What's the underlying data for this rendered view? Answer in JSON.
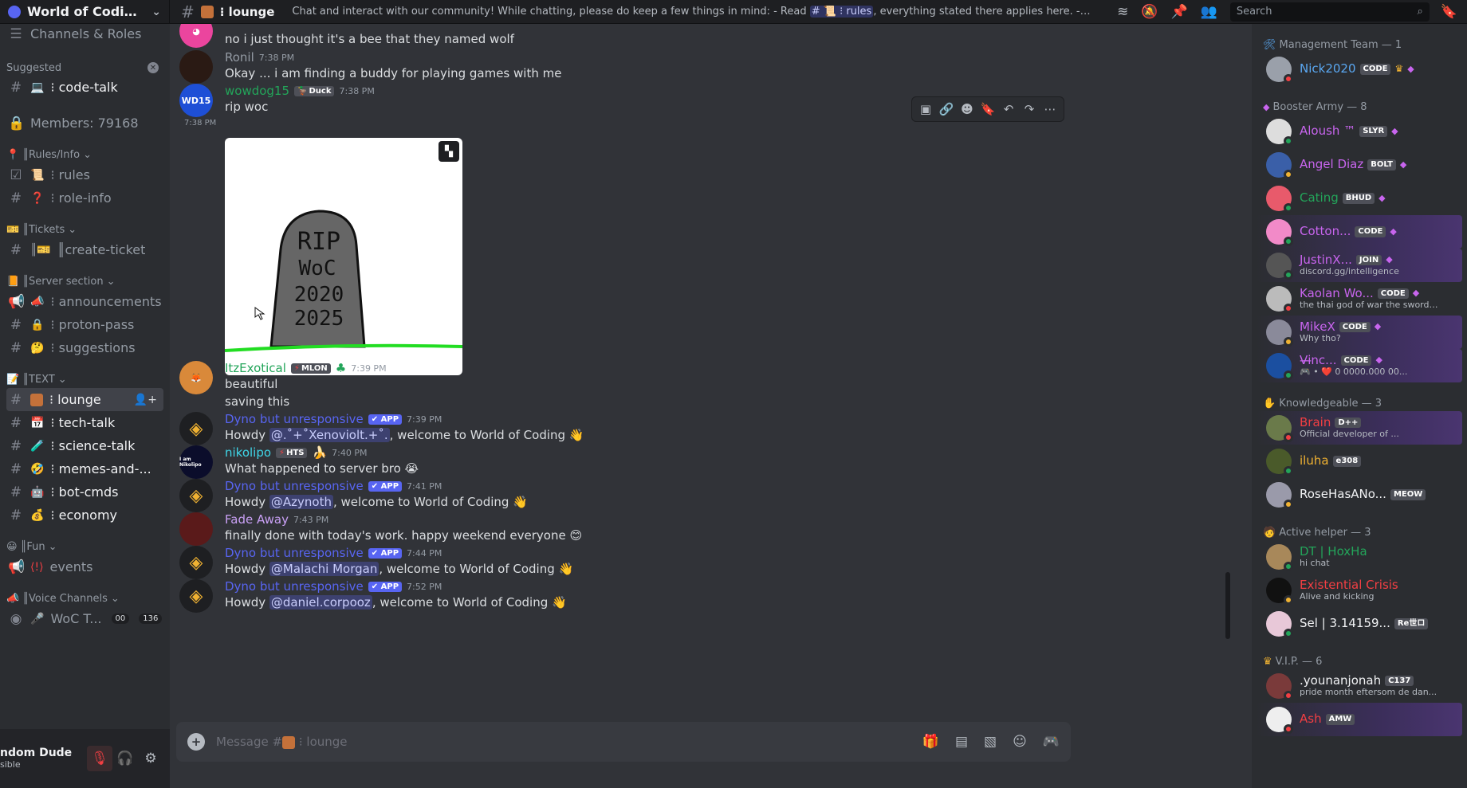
{
  "server": {
    "name": "World of Coding | ..."
  },
  "channel": {
    "name": "⁝ lounge",
    "topic_before": "Chat and interact with our community! While chatting, please do keep a few things in mind: - Read",
    "topic_mention": "# 📜 ⁝ rules",
    "topic_after": ", everything stated there applies here. - All memes ..."
  },
  "search": {
    "placeholder": "Search"
  },
  "sidebar": {
    "channels_roles": "Channels & Roles",
    "suggested_label": "Suggested",
    "suggested_channel": "⁝ code-talk",
    "members_count": "Members: 79168",
    "categories": {
      "rules_info": "║Rules/Info",
      "tickets": "║Tickets",
      "server_section": "║Server section",
      "text": "║TEXT",
      "fun": "║Fun",
      "voice": "║Voice Channels"
    },
    "channels": {
      "rules": "⁝ rules",
      "role_info": "⁝ role-info",
      "create_ticket": "║create-ticket",
      "announcements": "⁝ announcements",
      "proton_pass": "⁝ proton-pass",
      "suggestions": "⁝ suggestions",
      "lounge": "⁝ lounge",
      "tech_talk": "⁝ tech-talk",
      "science_talk": "⁝ science-talk",
      "memes": "⁝ memes-and-...",
      "bot_cmds": "⁝ bot-cmds",
      "economy": "⁝ economy",
      "events": "events",
      "voice_woc": "WoC T...",
      "voice_badge_a": "00",
      "voice_badge_b": "136"
    }
  },
  "user": {
    "name": "ndom Dude",
    "status": "sible"
  },
  "messages": {
    "m0_text": "no i just thought it's a bee that they named wolf",
    "m1_author": "Ronil",
    "m1_time": "7:38 PM",
    "m1_text": "Okay ... i am finding a buddy for playing games with me",
    "m2_author": "wowdog15",
    "m2_tag": "Duck",
    "m2_time": "7:38 PM",
    "m2_text": "rip woc",
    "m2_avatar": "WD15",
    "m2_side_time": "7:38 PM",
    "tomb_lines": [
      "RIP",
      "WoC",
      "2020",
      "2025"
    ],
    "m3_author": "ItzExotical",
    "m3_tag": "MLON",
    "m3_time": "7:39 PM",
    "m3_text1": "beautiful",
    "m3_text2": "saving this",
    "dyno_name": "Dyno but unresponsive",
    "app_label": "APP",
    "m4_time": "7:39 PM",
    "m4_pre": "Howdy",
    "m4_mention": "@.˚+˚Xenoviolt.+˚.",
    "m4_post": ", welcome to World of Coding",
    "m5_author": "nikolipo",
    "m5_tag": "HTS",
    "m5_time": "7:40 PM",
    "m5_text": "What happened to server bro 😭",
    "m5_avatar": "I am Nikolipo",
    "m6_time": "7:41 PM",
    "m6_mention": "@Azynoth",
    "m7_author": "Fade Away",
    "m7_time": "7:43 PM",
    "m7_text": "finally done with today's work. happy weekend everyone 😊",
    "m8_time": "7:44 PM",
    "m8_mention": "@Malachi Morgan",
    "m9_time": "7:52 PM",
    "m9_mention": "@daniel.corpooz"
  },
  "composer": {
    "placeholder_pre": "Message #",
    "placeholder_post": "⁝ lounge"
  },
  "member_list": {
    "groups": {
      "management": "Management Team — 1",
      "booster": "Booster Army — 8",
      "knowledgeable": "Knowledgeable — 3",
      "active_helper": "Active helper — 3",
      "vip": "V.I.P. — 6"
    },
    "nick": {
      "name": "Nick2020",
      "tag": "CODE"
    },
    "aloush": {
      "name": "Aloush ™",
      "tag": "SLYR"
    },
    "angel": {
      "name": "Angel Diaz",
      "tag": "BOLT"
    },
    "cating": {
      "name": "Cating",
      "tag": "BHUD"
    },
    "cotton": {
      "name": "Cotton...",
      "tag": "CODE"
    },
    "justin": {
      "name": "JustinX...",
      "tag": "JOIN",
      "sub": "discord.gg/intelligence"
    },
    "kaolan": {
      "name": "Kaolan Wo...",
      "tag": "CODE",
      "sub": "the thai god of war the sword ..."
    },
    "mikex": {
      "name": "MikeX",
      "tag": "CODE",
      "sub": "Why tho?"
    },
    "vince": {
      "name": "V̶i̶nc...",
      "tag": "CODE",
      "sub": "🎮 • ❤️ 0 0000.000 00..."
    },
    "brain": {
      "name": "Brain",
      "tag": "D++",
      "sub": "Official developer of ..."
    },
    "iluha": {
      "name": "iluha",
      "tag": "e308"
    },
    "rose": {
      "name": "RoseHasANo...",
      "tag": "MEOW"
    },
    "dt": {
      "name": "DT | HoxHa",
      "sub": "hi chat"
    },
    "crisis": {
      "name": "Existential Crisis",
      "sub": "Alive and kicking"
    },
    "sel": {
      "name": "Sel | 3.14159...",
      "tag": "Re世ロ"
    },
    "younan": {
      "name": ".younanjonah",
      "tag": "C137",
      "sub": "pride month eftersom de dan..."
    },
    "ash": {
      "name": "Ash",
      "tag": "AMW"
    }
  },
  "colors": {
    "accent": "#5865f2",
    "online": "#23a55a",
    "idle": "#f0b232",
    "dnd": "#f23f43",
    "booster": "#c865ee"
  }
}
